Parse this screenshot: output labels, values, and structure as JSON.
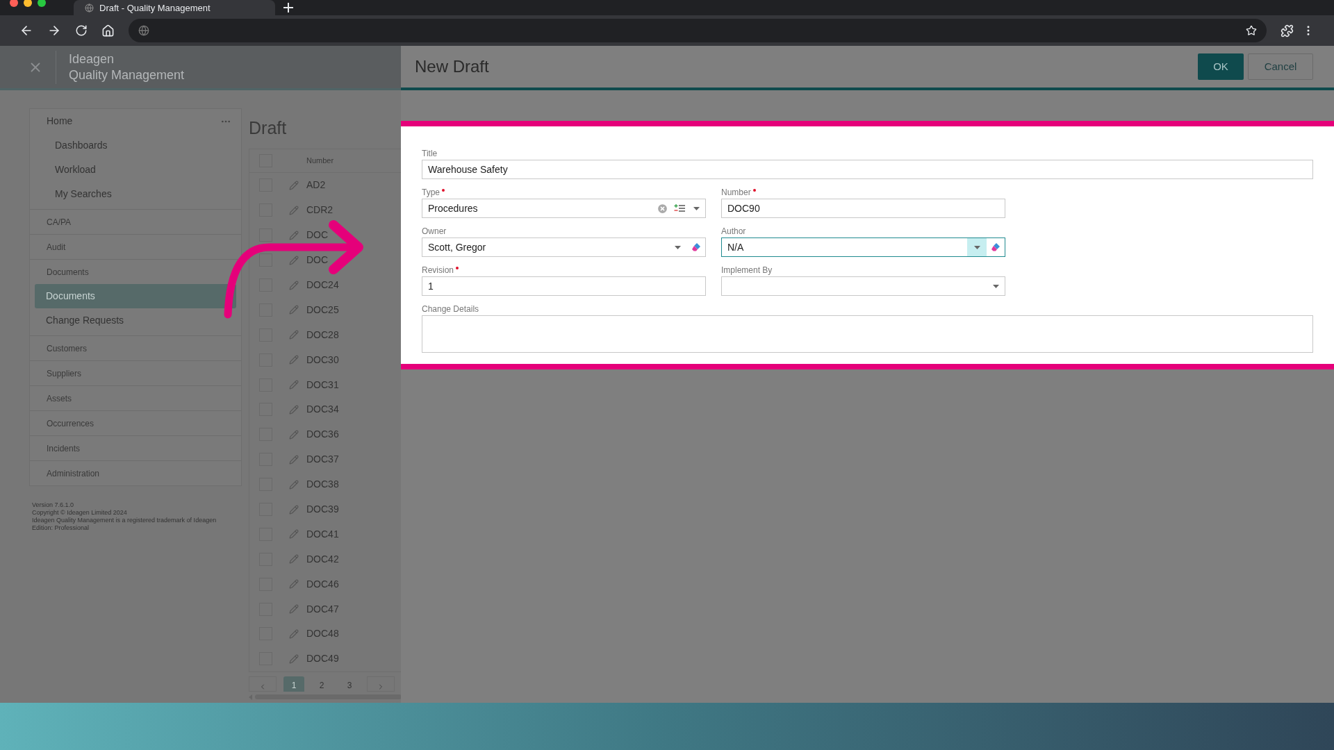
{
  "browser": {
    "tab_title": "Draft - Quality Management"
  },
  "app_header": {
    "brand": "Ideagen",
    "product": "Quality Management"
  },
  "sidebar": {
    "items": [
      {
        "label": "Home",
        "kind": "link",
        "selected": false,
        "children": [
          {
            "label": "Dashboards",
            "selected": false
          },
          {
            "label": "Workload",
            "selected": false
          },
          {
            "label": "My Searches",
            "selected": false
          }
        ]
      },
      {
        "label": "CA/PA",
        "kind": "section",
        "selected": false
      },
      {
        "label": "Audit",
        "kind": "section",
        "selected": false
      },
      {
        "label": "Documents",
        "kind": "section",
        "selected": false,
        "children": [
          {
            "label": "Documents",
            "selected": true
          },
          {
            "label": "Change Requests",
            "selected": false
          }
        ]
      },
      {
        "label": "Customers",
        "kind": "section",
        "selected": false
      },
      {
        "label": "Suppliers",
        "kind": "section",
        "selected": false
      },
      {
        "label": "Assets",
        "kind": "section",
        "selected": false
      },
      {
        "label": "Occurrences",
        "kind": "section",
        "selected": false
      },
      {
        "label": "Incidents",
        "kind": "section",
        "selected": false
      },
      {
        "label": "Administration",
        "kind": "section",
        "selected": false
      }
    ],
    "footer": [
      "Version 7.6.1.0",
      "Copyright © Ideagen Limited 2024",
      "Ideagen Quality Management is a registered trademark of Ideagen",
      "Edition: Professional"
    ]
  },
  "draft_list": {
    "title": "Draft",
    "all_checked": false,
    "columns": [
      "Number"
    ],
    "rows": [
      {
        "number": "AD2",
        "checked": false
      },
      {
        "number": "CDR2",
        "checked": false
      },
      {
        "number": "DOC",
        "checked": false
      },
      {
        "number": "DOC",
        "checked": false
      },
      {
        "number": "DOC24",
        "checked": false
      },
      {
        "number": "DOC25",
        "checked": false
      },
      {
        "number": "DOC28",
        "checked": false
      },
      {
        "number": "DOC30",
        "checked": false
      },
      {
        "number": "DOC31",
        "checked": false
      },
      {
        "number": "DOC34",
        "checked": false
      },
      {
        "number": "DOC36",
        "checked": false
      },
      {
        "number": "DOC37",
        "checked": false
      },
      {
        "number": "DOC38",
        "checked": false
      },
      {
        "number": "DOC39",
        "checked": false
      },
      {
        "number": "DOC41",
        "checked": false
      },
      {
        "number": "DOC42",
        "checked": false
      },
      {
        "number": "DOC46",
        "checked": false
      },
      {
        "number": "DOC47",
        "checked": false
      },
      {
        "number": "DOC48",
        "checked": false
      },
      {
        "number": "DOC49",
        "checked": false
      }
    ],
    "pages": [
      {
        "label": "1",
        "selected": true
      },
      {
        "label": "2",
        "selected": false
      },
      {
        "label": "3",
        "selected": false
      }
    ]
  },
  "dialog": {
    "title": "New Draft",
    "buttons": [
      {
        "label": "OK",
        "kind": "primary"
      },
      {
        "label": "Cancel",
        "kind": "secondary"
      }
    ],
    "rows": [
      {
        "fields": [
          {
            "label": "Title",
            "kind": "text",
            "required": false,
            "focused": false,
            "value": "Warehouse Safety"
          }
        ]
      },
      {
        "fields": [
          {
            "label": "Type",
            "kind": "type-select",
            "required": true,
            "focused": false,
            "value": "Procedures"
          },
          {
            "label": "Number",
            "kind": "text",
            "required": true,
            "focused": false,
            "value": "DOC90"
          }
        ]
      },
      {
        "fields": [
          {
            "label": "Owner",
            "kind": "user-select",
            "required": false,
            "focused": false,
            "value": "Scott, Gregor"
          },
          {
            "label": "Author",
            "kind": "user-select",
            "required": false,
            "focused": true,
            "value": "N/A"
          }
        ]
      },
      {
        "fields": [
          {
            "label": "Revision",
            "kind": "text",
            "required": true,
            "focused": false,
            "value": "1"
          },
          {
            "label": "Implement By",
            "kind": "date-select",
            "required": false,
            "focused": false
          }
        ]
      },
      {
        "fields": [
          {
            "label": "Change Details",
            "kind": "textarea",
            "required": false,
            "focused": false
          }
        ]
      }
    ]
  }
}
